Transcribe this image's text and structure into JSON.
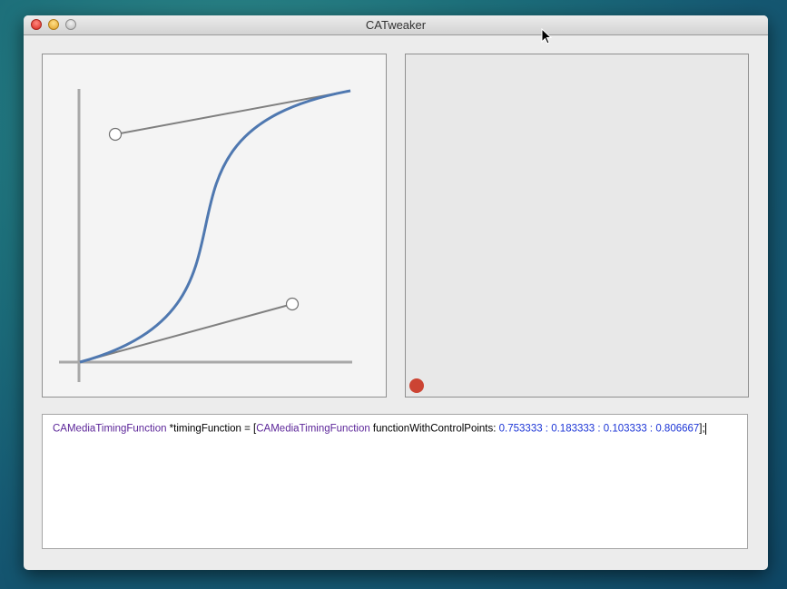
{
  "window": {
    "title": "CATweaker"
  },
  "curve": {
    "control_points": [
      0.753333,
      0.183333,
      0.103333,
      0.806667
    ],
    "curve_color": "#4f78b0",
    "handle_color": "#808080"
  },
  "preview": {
    "dot_color": "#cc4433"
  },
  "code": {
    "type1": "CAMediaTimingFunction",
    "decl": " *timingFunction = [",
    "type2": "CAMediaTimingFunction",
    "selector": " functionWithControlPoints: ",
    "v1": "0.753333",
    "sep1": " : ",
    "v2": "0.183333",
    "sep2": " : ",
    "v3": "0.103333",
    "sep3": " : ",
    "v4": "0.806667",
    "end": "];"
  }
}
